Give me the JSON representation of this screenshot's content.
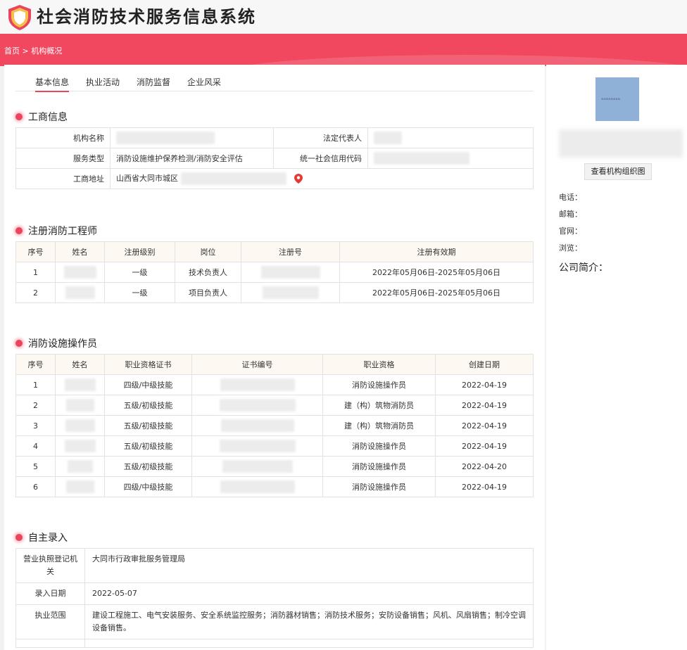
{
  "header": {
    "title": "社会消防技术服务信息系统"
  },
  "breadcrumb": {
    "home": "首页",
    "separator": " > ",
    "current": "机构概况"
  },
  "tabs": [
    {
      "label": "基本信息",
      "active": true
    },
    {
      "label": "执业活动",
      "active": false
    },
    {
      "label": "消防监督",
      "active": false
    },
    {
      "label": "企业风采",
      "active": false
    }
  ],
  "business": {
    "title": "工商信息",
    "org_name_label": "机构名称",
    "legal_rep_label": "法定代表人",
    "service_type_label": "服务类型",
    "service_type_value": "消防设施维护保养检测/消防安全评估",
    "credit_code_label": "统一社会信用代码",
    "address_label": "工商地址",
    "address_value": "山西省大同市城区"
  },
  "engineers": {
    "title": "注册消防工程师",
    "headers": [
      "序号",
      "姓名",
      "注册级别",
      "岗位",
      "注册号",
      "注册有效期"
    ],
    "rows": [
      {
        "no": "1",
        "level": "一级",
        "post": "技术负责人",
        "validity": "2022年05月06日-2025年05月06日"
      },
      {
        "no": "2",
        "level": "一级",
        "post": "项目负责人",
        "validity": "2022年05月06日-2025年05月06日"
      }
    ]
  },
  "operators": {
    "title": "消防设施操作员",
    "headers": [
      "序号",
      "姓名",
      "职业资格证书",
      "证书编号",
      "职业资格",
      "创建日期"
    ],
    "rows": [
      {
        "no": "1",
        "cert": "四级/中级技能",
        "qual": "消防设施操作员",
        "date": "2022-04-19"
      },
      {
        "no": "2",
        "cert": "五级/初级技能",
        "qual": "建（构）筑物消防员",
        "date": "2022-04-19"
      },
      {
        "no": "3",
        "cert": "五级/初级技能",
        "qual": "建（构）筑物消防员",
        "date": "2022-04-19"
      },
      {
        "no": "4",
        "cert": "五级/初级技能",
        "qual": "消防设施操作员",
        "date": "2022-04-19"
      },
      {
        "no": "5",
        "cert": "五级/初级技能",
        "qual": "消防设施操作员",
        "date": "2022-04-20"
      },
      {
        "no": "6",
        "cert": "四级/中级技能",
        "qual": "消防设施操作员",
        "date": "2022-04-19"
      }
    ]
  },
  "self_entry": {
    "title": "自主录入",
    "authority_label": "营业执照登记机关",
    "authority_value": "大同市行政审批服务管理局",
    "date_label": "录入日期",
    "date_value": "2022-05-07",
    "scope_label": "执业范围",
    "scope_value": "建设工程施工、电气安装服务、安全系统监控服务；消防器材销售；消防技术服务；安防设备销售；风机、风扇销售；制冷空调设备销售。"
  },
  "sidebar": {
    "org_chart_button": "查看机构组织图",
    "phone_label": "电话：",
    "email_label": "邮箱：",
    "website_label": "官网：",
    "views_label": "浏览：",
    "intro_label": "公司简介："
  },
  "colors": {
    "accent": "#e8465d",
    "banner": "#f1475f",
    "header_row": "#fdf8f1"
  }
}
